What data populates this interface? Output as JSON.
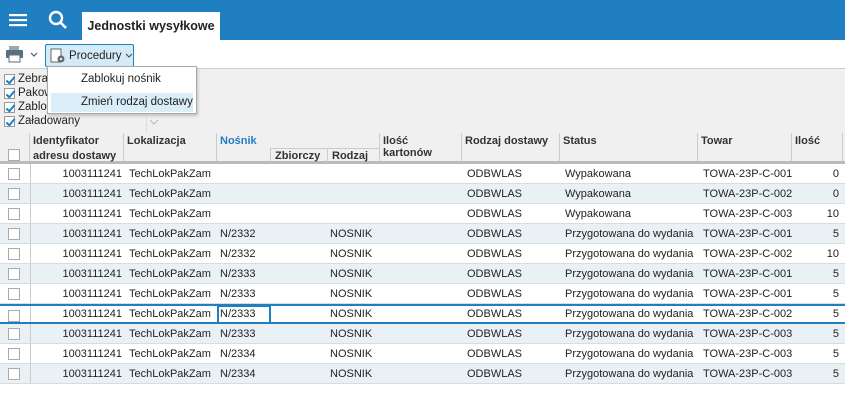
{
  "header": {
    "tab_label": "Jednostki wysyłkowe"
  },
  "toolbar": {
    "procedures_label": "Procedury"
  },
  "menu": {
    "items": [
      "Zablokuj nośnik",
      "Zmień rodzaj dostawy"
    ]
  },
  "filters": [
    {
      "label": "Zebra",
      "checked": true
    },
    {
      "label": "Pakow",
      "checked": true
    },
    {
      "label": "Zablo",
      "checked": true
    },
    {
      "label": "Załadowany",
      "checked": true
    }
  ],
  "columns": {
    "id": "Identyfikator",
    "id2": "adresu dostawy",
    "loc": "Lokalizacja",
    "carrier": "Nośnik",
    "zb": "Zbiorczy",
    "rodzaj": "Rodzaj",
    "cartons": "Ilość kartonów",
    "delivery": "Rodzaj dostawy",
    "status": "Status",
    "towar": "Towar",
    "qty": "Ilość"
  },
  "colors": {
    "accent": "#1f7fc0",
    "alt_row": "#e9f1f5"
  },
  "rows": [
    {
      "id": "1003111241",
      "loc": "TechLokPakZam",
      "carrier": "",
      "kind": "",
      "delivery": "ODBWLAS",
      "status": "Wypakowana",
      "towar": "TOWA-23P-C-001",
      "qty": "0"
    },
    {
      "id": "1003111241",
      "loc": "TechLokPakZam",
      "carrier": "",
      "kind": "",
      "delivery": "ODBWLAS",
      "status": "Wypakowana",
      "towar": "TOWA-23P-C-002",
      "qty": "0"
    },
    {
      "id": "1003111241",
      "loc": "TechLokPakZam",
      "carrier": "",
      "kind": "",
      "delivery": "ODBWLAS",
      "status": "Wypakowana",
      "towar": "TOWA-23P-C-003",
      "qty": "10"
    },
    {
      "id": "1003111241",
      "loc": "TechLokPakZam",
      "carrier": "N/2332",
      "kind": "NOSNIK",
      "delivery": "ODBWLAS",
      "status": "Przygotowana do wydania",
      "towar": "TOWA-23P-C-001",
      "qty": "5"
    },
    {
      "id": "1003111241",
      "loc": "TechLokPakZam",
      "carrier": "N/2332",
      "kind": "NOSNIK",
      "delivery": "ODBWLAS",
      "status": "Przygotowana do wydania",
      "towar": "TOWA-23P-C-002",
      "qty": "10"
    },
    {
      "id": "1003111241",
      "loc": "TechLokPakZam",
      "carrier": "N/2333",
      "kind": "NOSNIK",
      "delivery": "ODBWLAS",
      "status": "Przygotowana do wydania",
      "towar": "TOWA-23P-C-001",
      "qty": "5"
    },
    {
      "id": "1003111241",
      "loc": "TechLokPakZam",
      "carrier": "N/2333",
      "kind": "NOSNIK",
      "delivery": "ODBWLAS",
      "status": "Przygotowana do wydania",
      "towar": "TOWA-23P-C-001",
      "qty": "5"
    },
    {
      "id": "1003111241",
      "loc": "TechLokPakZam",
      "carrier": "N/2333",
      "kind": "NOSNIK",
      "delivery": "ODBWLAS",
      "status": "Przygotowana do wydania",
      "towar": "TOWA-23P-C-002",
      "qty": "5"
    },
    {
      "id": "1003111241",
      "loc": "TechLokPakZam",
      "carrier": "N/2333",
      "kind": "NOSNIK",
      "delivery": "ODBWLAS",
      "status": "Przygotowana do wydania",
      "towar": "TOWA-23P-C-003",
      "qty": "5"
    },
    {
      "id": "1003111241",
      "loc": "TechLokPakZam",
      "carrier": "N/2334",
      "kind": "NOSNIK",
      "delivery": "ODBWLAS",
      "status": "Przygotowana do wydania",
      "towar": "TOWA-23P-C-003",
      "qty": "5"
    },
    {
      "id": "1003111241",
      "loc": "TechLokPakZam",
      "carrier": "N/2334",
      "kind": "NOSNIK",
      "delivery": "ODBWLAS",
      "status": "Przygotowana do wydania",
      "towar": "TOWA-23P-C-003",
      "qty": "5"
    }
  ]
}
